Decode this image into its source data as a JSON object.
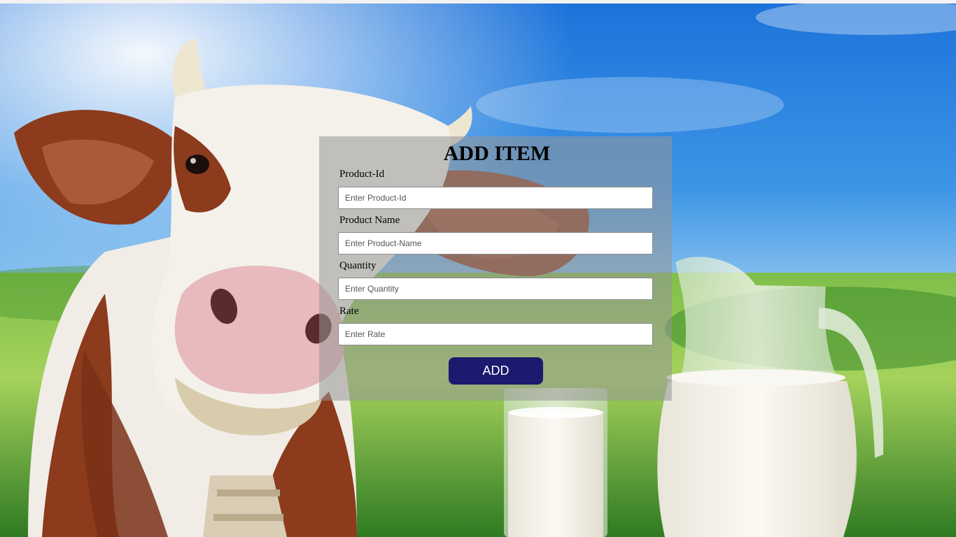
{
  "form": {
    "title": "ADD ITEM",
    "fields": [
      {
        "label": "Product-Id",
        "placeholder": "Enter Product-Id",
        "value": ""
      },
      {
        "label": "Product Name",
        "placeholder": "Enter Product-Name",
        "value": ""
      },
      {
        "label": "Quantity",
        "placeholder": "Enter Quantity",
        "value": ""
      },
      {
        "label": "Rate",
        "placeholder": "Enter Rate",
        "value": ""
      }
    ],
    "submit_label": "ADD"
  },
  "background": {
    "image_subject": "cow-and-milk-photo",
    "colors": {
      "sky_top": "#1a6fd8",
      "sky_light": "#9fd0f5",
      "grass": "#6fb43a",
      "cow_brown": "#8a3a1c",
      "cow_white": "#f3efe8",
      "milk": "#f4f1e8"
    }
  },
  "colors": {
    "panel": "#969696",
    "button": "#1b1a6e",
    "button_text": "#ffffff"
  }
}
